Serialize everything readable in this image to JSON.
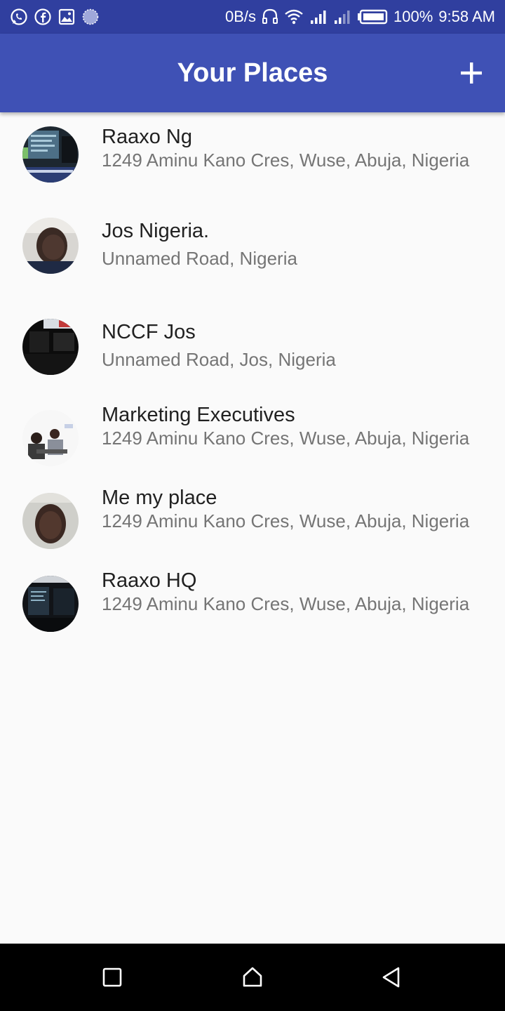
{
  "status_bar": {
    "net_speed": "0B/s",
    "battery": "100%",
    "time": "9:58 AM",
    "icons": [
      "whatsapp-icon",
      "facebook-icon",
      "gallery-icon",
      "sync-icon",
      "headset-icon",
      "wifi-icon",
      "signal-icon",
      "signal-weak-icon",
      "battery-icon"
    ]
  },
  "app_bar": {
    "title": "Your Places",
    "color": "#3f51b5",
    "add_icon": "plus-icon"
  },
  "places": [
    {
      "name": "Raaxo Ng",
      "address": "1249 Aminu Kano Cres, Wuse, Abuja, Nigeria"
    },
    {
      "name": "Jos Nigeria.",
      "address": "Unnamed Road, Nigeria"
    },
    {
      "name": "NCCF Jos",
      "address": "Unnamed Road, Jos, Nigeria"
    },
    {
      "name": "Marketing Executives",
      "address": "1249 Aminu Kano Cres, Wuse, Abuja, Nigeria"
    },
    {
      "name": "Me my place",
      "address": "1249 Aminu Kano Cres, Wuse, Abuja, Nigeria"
    },
    {
      "name": "Raaxo HQ",
      "address": "1249 Aminu Kano Cres, Wuse, Abuja, Nigeria"
    }
  ],
  "nav_bar": {
    "icons": [
      "recent-apps-icon",
      "home-icon",
      "back-icon"
    ]
  }
}
